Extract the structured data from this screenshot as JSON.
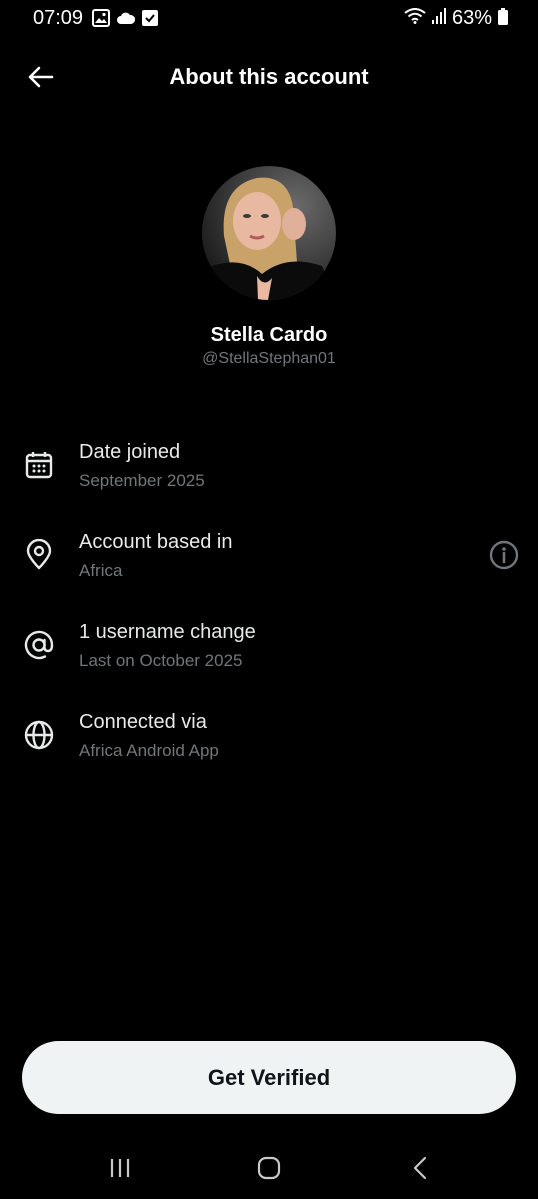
{
  "status_bar": {
    "time": "07:09",
    "battery": "63%",
    "icons": [
      "gallery-icon",
      "cloud-icon",
      "checkbox-icon",
      "wifi-icon",
      "signal-icon",
      "battery-icon"
    ]
  },
  "header": {
    "title": "About this account",
    "back_icon": "arrow-left-icon"
  },
  "profile": {
    "name": "Stella Cardo",
    "handle": "@StellaStephan01"
  },
  "rows": [
    {
      "icon": "calendar-icon",
      "title": "Date joined",
      "subtitle": "September 2025"
    },
    {
      "icon": "location-pin-icon",
      "title": "Account based in",
      "subtitle": "Africa",
      "trailing_icon": "info-icon"
    },
    {
      "icon": "at-sign-icon",
      "title": "1 username change",
      "subtitle": "Last on October 2025"
    },
    {
      "icon": "globe-icon",
      "title": "Connected via",
      "subtitle": "Africa Android App"
    }
  ],
  "verify_button": {
    "label": "Get Verified"
  },
  "nav_bar": {
    "icons": [
      "recent-apps-icon",
      "home-icon",
      "back-icon"
    ]
  },
  "colors": {
    "background": "#000000",
    "primary_text": "#e7e9ea",
    "secondary_text": "#71767b",
    "button_bg": "#eff3f4",
    "button_text": "#0f1419"
  }
}
